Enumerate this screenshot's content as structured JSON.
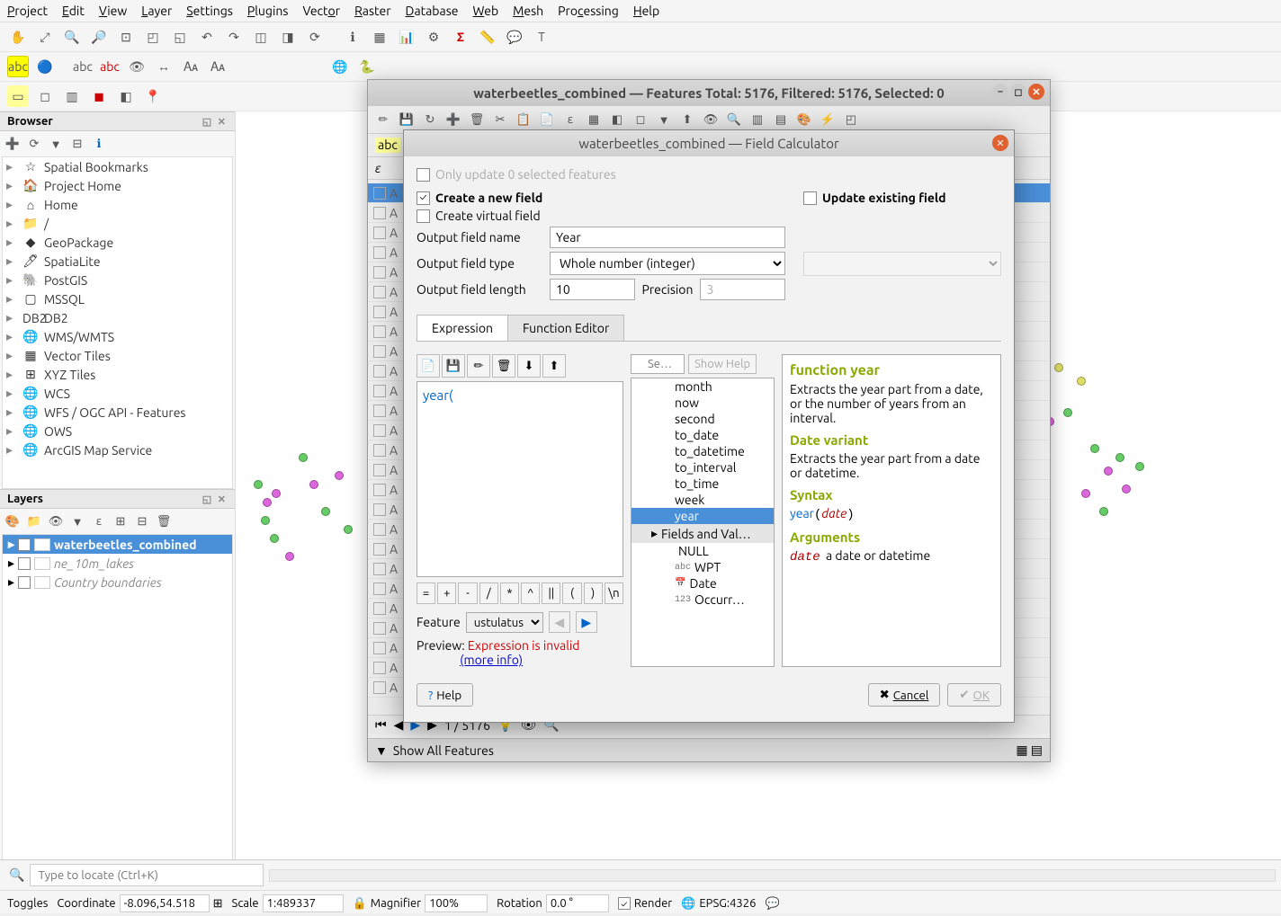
{
  "menu": [
    "Project",
    "Edit",
    "View",
    "Layer",
    "Settings",
    "Plugins",
    "Vector",
    "Raster",
    "Database",
    "Web",
    "Mesh",
    "Processing",
    "Help"
  ],
  "panels": {
    "browser": "Browser",
    "layers": "Layers"
  },
  "browser_items": [
    {
      "icon": "☆",
      "label": "Spatial Bookmarks"
    },
    {
      "icon": "🏠",
      "label": "Project Home"
    },
    {
      "icon": "⌂",
      "label": "Home"
    },
    {
      "icon": "📁",
      "label": "/"
    },
    {
      "icon": "◆",
      "label": "GeoPackage"
    },
    {
      "icon": "🖊",
      "label": "SpatiaLite"
    },
    {
      "icon": "🐘",
      "label": "PostGIS"
    },
    {
      "icon": "▢",
      "label": "MSSQL"
    },
    {
      "icon": "DB2",
      "label": "DB2"
    },
    {
      "icon": "🌐",
      "label": "WMS/WMTS"
    },
    {
      "icon": "▦",
      "label": "Vector Tiles"
    },
    {
      "icon": "⊞",
      "label": "XYZ Tiles"
    },
    {
      "icon": "🌐",
      "label": "WCS"
    },
    {
      "icon": "🌐",
      "label": "WFS / OGC API - Features"
    },
    {
      "icon": "🌐",
      "label": "OWS"
    },
    {
      "icon": "🌐",
      "label": "ArcGIS Map Service"
    }
  ],
  "layers": [
    {
      "checked": true,
      "selected": true,
      "label": "waterbeetles_combined"
    },
    {
      "checked": false,
      "selected": false,
      "label": "ne_10m_lakes",
      "italic": true
    },
    {
      "checked": false,
      "selected": false,
      "label": "Country boundaries",
      "italic": true
    }
  ],
  "attr_window": {
    "title": "waterbeetles_combined — Features Total: 5176, Filtered: 5176, Selected: 0",
    "nav": "1 / 5176",
    "show_all": "Show All Features"
  },
  "fc": {
    "title": "waterbeetles_combined — Field Calculator",
    "only_update": "Only update 0 selected features",
    "create_new": "Create a new field",
    "create_virtual": "Create virtual field",
    "update_existing": "Update existing field",
    "out_name_label": "Output field name",
    "out_name": "Year",
    "out_type_label": "Output field type",
    "out_type": "Whole number (integer)",
    "out_len_label": "Output field length",
    "out_len": "10",
    "precision_label": "Precision",
    "precision": "3",
    "tab_expr": "Expression",
    "tab_func": "Function Editor",
    "expr_text": "year(",
    "ops": [
      "=",
      "+",
      "-",
      "/",
      "*",
      "^",
      "||",
      "(",
      ")",
      "\\n"
    ],
    "feature_label": "Feature",
    "feature_sel": "ustulatus",
    "preview_label": "Preview:",
    "preview_err": "Expression is invalid",
    "preview_link": "(more info)",
    "search_placeholder": "Se…",
    "show_help": "Show Help",
    "func_items": [
      "month",
      "now",
      "second",
      "to_date",
      "to_datetime",
      "to_interval",
      "to_time",
      "week",
      "year"
    ],
    "fields_cat": "Fields and Val…",
    "field_subs": [
      {
        "t": "",
        "l": "NULL"
      },
      {
        "t": "abc",
        "l": "WPT"
      },
      {
        "t": "📅",
        "l": "Date"
      },
      {
        "t": "123",
        "l": "Occurr…"
      }
    ],
    "help": {
      "h": "function year",
      "p1": "Extracts the year part from a date, or the number of years from an interval.",
      "h2": "Date variant",
      "p2": "Extracts the year part from a date or datetime.",
      "h3": "Syntax",
      "syntax_fn": "year",
      "syntax_arg": "date",
      "h4": "Arguments",
      "arg_name": "date",
      "arg_desc": "a date or datetime"
    },
    "btn_help": "Help",
    "btn_cancel": "Cancel",
    "btn_ok": "OK"
  },
  "status": {
    "locate_placeholder": "Type to locate (Ctrl+K)",
    "toggles": "Toggles",
    "coord_label": "Coordinate",
    "coord": "-8.096,54.518",
    "scale_label": "Scale",
    "scale": "1:489337",
    "mag_label": "Magnifier",
    "mag": "100%",
    "rot_label": "Rotation",
    "rot": "0.0 °",
    "render": "Render",
    "epsg": "EPSG:4326"
  }
}
